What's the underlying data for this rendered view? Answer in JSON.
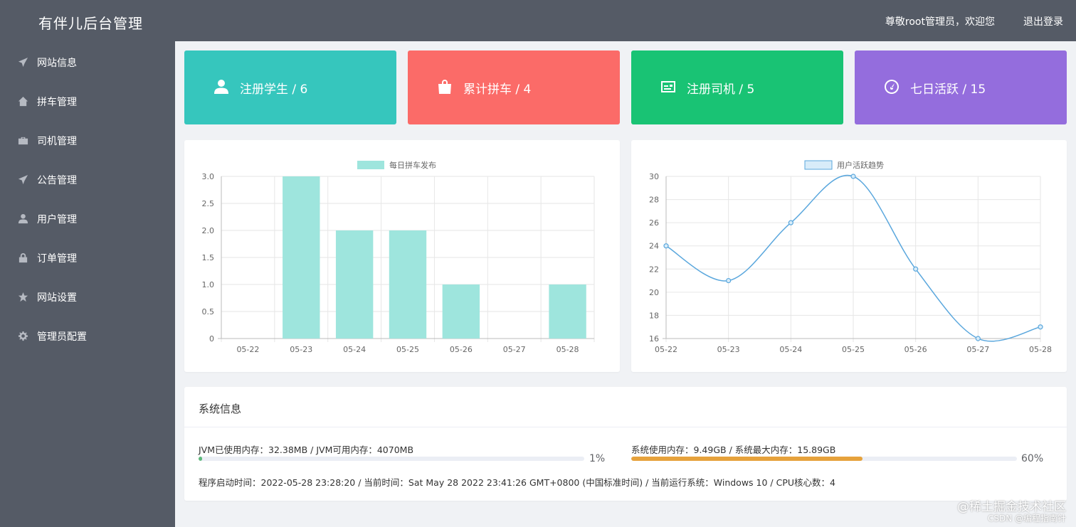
{
  "app": {
    "title": "有伴儿后台管理"
  },
  "header": {
    "welcome": "尊敬root管理员，欢迎您",
    "logout": "退出登录"
  },
  "sidebar": {
    "items": [
      {
        "label": "网站信息",
        "icon": "paper-plane-icon"
      },
      {
        "label": "拼车管理",
        "icon": "home-icon"
      },
      {
        "label": "司机管理",
        "icon": "briefcase-icon"
      },
      {
        "label": "公告管理",
        "icon": "paper-plane-icon"
      },
      {
        "label": "用户管理",
        "icon": "user-icon"
      },
      {
        "label": "订单管理",
        "icon": "lock-icon"
      },
      {
        "label": "网站设置",
        "icon": "star-icon"
      },
      {
        "label": "管理员配置",
        "icon": "gear-icon"
      }
    ]
  },
  "stats": [
    {
      "label": "注册学生 / 6",
      "icon": "user-icon",
      "color": "#36c6bd"
    },
    {
      "label": "累计拼车 / 4",
      "icon": "shopping-bag-icon",
      "color": "#fb6b68"
    },
    {
      "label": "注册司机 / 5",
      "icon": "id-card-icon",
      "color": "#19c374"
    },
    {
      "label": "七日活跃 / 15",
      "icon": "dashboard-icon",
      "color": "#946ddd"
    }
  ],
  "chart_data": [
    {
      "type": "bar",
      "legend": "每日拼车发布",
      "categories": [
        "05-22",
        "05-23",
        "05-24",
        "05-25",
        "05-26",
        "05-27",
        "05-28"
      ],
      "values": [
        0,
        3,
        2,
        2,
        1,
        0,
        1
      ],
      "ylim": [
        0,
        3
      ],
      "yticks": [
        "0",
        "0.5",
        "1.0",
        "1.5",
        "2.0",
        "2.5",
        "3.0"
      ],
      "color": "#9ee5dd",
      "grid": true,
      "legend_position": "top-center"
    },
    {
      "type": "line",
      "legend": "用户活跃趋势",
      "categories": [
        "05-22",
        "05-23",
        "05-24",
        "05-25",
        "05-26",
        "05-27",
        "05-28"
      ],
      "values": [
        24,
        21,
        26,
        30,
        22,
        16,
        17
      ],
      "ylim": [
        16,
        30
      ],
      "yticks": [
        "16",
        "18",
        "20",
        "22",
        "24",
        "26",
        "28",
        "30"
      ],
      "color": "#5aa7dd",
      "fill": "#d8ecf9",
      "grid": true,
      "legend_position": "top-center"
    }
  ],
  "system": {
    "title": "系统信息",
    "jvm_text": "JVM已使用内存：32.38MB / JVM可用内存：4070MB",
    "jvm_percent": 1,
    "jvm_percent_label": "1%",
    "jvm_color": "#5cb87a",
    "mem_text": "系统使用内存：9.49GB / 系统最大内存：15.89GB",
    "mem_percent": 60,
    "mem_percent_label": "60%",
    "mem_color": "#e6a23c",
    "runtime_text": "程序启动时间：2022-05-28 23:28:20 / 当前时间：Sat May 28 2022 23:41:26 GMT+0800 (中国标准时间) / 当前运行系统：Windows 10 / CPU核心数：4"
  },
  "watermark": {
    "line1": "@稀土掘金技术社区",
    "line2": "CSDN @编程指南针"
  }
}
